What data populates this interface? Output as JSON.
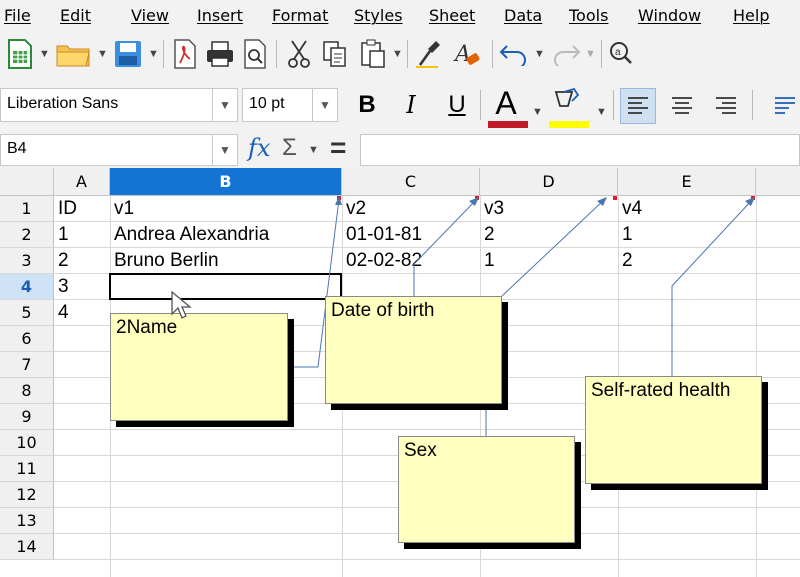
{
  "menu": [
    "File",
    "Edit",
    "View",
    "Insert",
    "Format",
    "Styles",
    "Sheet",
    "Data",
    "Tools",
    "Window",
    "Help"
  ],
  "toolbar": {
    "font_name": "Liberation Sans",
    "font_size": "10 pt",
    "bold_label": "B",
    "italic_label": "I",
    "underline_label": "U",
    "font_color_label": "A",
    "font_color": "#c01c28",
    "highlight_color": "#ffff00"
  },
  "formula_bar": {
    "cell_ref": "B4",
    "fx_label": "fx",
    "sum_label": "Σ",
    "equals_label": "=",
    "content": ""
  },
  "columns": [
    "A",
    "B",
    "C",
    "D",
    "E"
  ],
  "rows": [
    "1",
    "2",
    "3",
    "4",
    "5",
    "6",
    "7",
    "8",
    "9",
    "10",
    "11",
    "12",
    "13",
    "14"
  ],
  "selected_cell": "B4",
  "cells": {
    "A1": "ID",
    "B1": "v1",
    "C1": "v2",
    "D1": "v3",
    "E1": "v4",
    "A2": "1",
    "B2": "Andrea Alexandria",
    "C2": "01-01-81",
    "D2": "2",
    "E2": "1",
    "A3": "2",
    "B3": "Bruno Berlin",
    "C3": "02-02-82",
    "D3": "1",
    "E3": "2",
    "A4": "3",
    "A5": "4"
  },
  "comments": {
    "B1": "2Name",
    "C1": "Date of birth",
    "D1": "Sex",
    "E1": "Self-rated health"
  },
  "colors": {
    "note_bg": "#ffffc0",
    "selected_header": "#1474d4",
    "accent": "#1a5fb4"
  }
}
